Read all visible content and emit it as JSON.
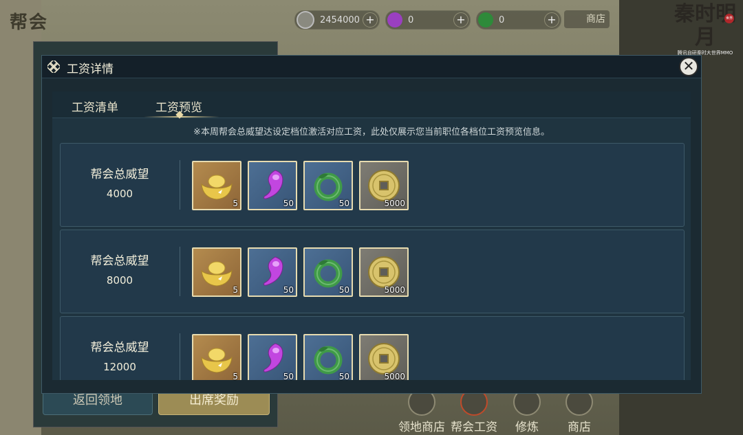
{
  "background": {
    "guild_title": "帮会",
    "resources": [
      {
        "name": "coin",
        "value": "2454000"
      },
      {
        "name": "purple-gem",
        "value": "0"
      },
      {
        "name": "jade",
        "value": "0"
      }
    ],
    "shop_label": "商店",
    "logo_text": "秦时明月",
    "logo_sub": "腾讯自研秦时大世界MMO",
    "logo_badge": "世界",
    "back_buttons": [
      "返回领地",
      "出席奖励"
    ],
    "bottom_nav": [
      "领地商店",
      "帮会工资",
      "修炼",
      "商店"
    ]
  },
  "dialog": {
    "title": "工资详情",
    "close_icon": "close-icon",
    "tabs": [
      {
        "label": "工资清单",
        "active": false
      },
      {
        "label": "工资预览",
        "active": true
      }
    ],
    "notice": "※本周帮会总威望达设定档位激活对应工资，此处仅展示您当前职位各档位工资预览信息。",
    "tiers": [
      {
        "label": "帮会总威望",
        "value": "4000",
        "rewards": [
          {
            "icon": "gold-ingot-icon",
            "count": "5"
          },
          {
            "icon": "purple-jade-icon",
            "count": "50"
          },
          {
            "icon": "green-jade-ring-icon",
            "count": "50"
          },
          {
            "icon": "copper-coin-icon",
            "count": "5000"
          }
        ]
      },
      {
        "label": "帮会总威望",
        "value": "8000",
        "rewards": [
          {
            "icon": "gold-ingot-icon",
            "count": "5"
          },
          {
            "icon": "purple-jade-icon",
            "count": "50"
          },
          {
            "icon": "green-jade-ring-icon",
            "count": "50"
          },
          {
            "icon": "copper-coin-icon",
            "count": "5000"
          }
        ]
      },
      {
        "label": "帮会总威望",
        "value": "12000",
        "rewards": [
          {
            "icon": "gold-ingot-icon",
            "count": "5"
          },
          {
            "icon": "purple-jade-icon",
            "count": "50"
          },
          {
            "icon": "green-jade-ring-icon",
            "count": "50"
          },
          {
            "icon": "copper-coin-icon",
            "count": "5000"
          }
        ]
      }
    ]
  },
  "colors": {
    "dialog_bg": "#1b2a32",
    "row_bg": "#22394a",
    "text": "#f3efdb",
    "item_border": "#e8dcb0"
  }
}
